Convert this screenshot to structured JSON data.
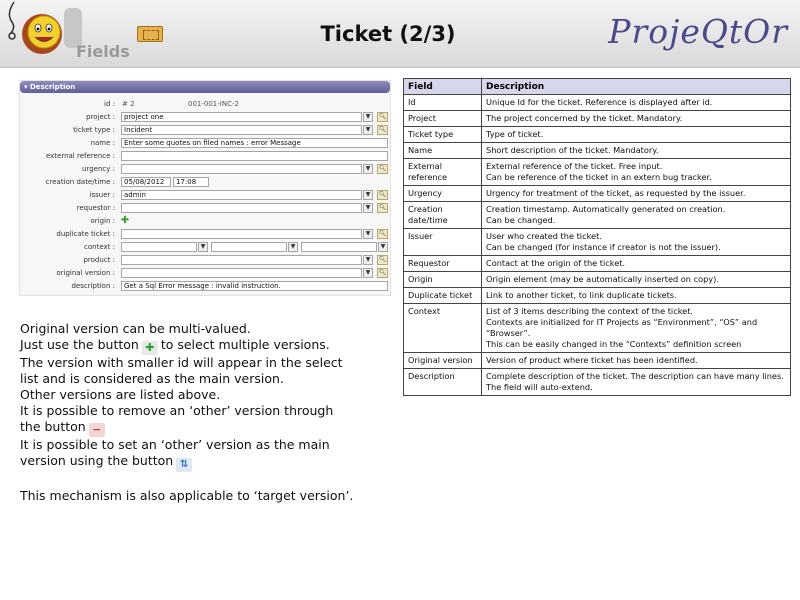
{
  "header": {
    "fields_label": "Fields",
    "title": "Ticket (2/3)",
    "brand": "ProjeQtOr"
  },
  "form": {
    "section_title": "Description",
    "fields": [
      {
        "label": "id :",
        "value": "# 2",
        "extra": "001-001-INC-2"
      },
      {
        "label": "project :",
        "value": "project one"
      },
      {
        "label": "ticket type :",
        "value": "Incident"
      },
      {
        "label": "name :",
        "value": "Enter some quotes on filed names : error Message"
      },
      {
        "label": "external reference :",
        "value": ""
      },
      {
        "label": "urgency :",
        "value": ""
      },
      {
        "label": "creation date/time :",
        "value": "05/08/2012",
        "extra": "17:08"
      },
      {
        "label": "issuer :",
        "value": "admin"
      },
      {
        "label": "requestor :",
        "value": ""
      },
      {
        "label": "origin :",
        "value": ""
      },
      {
        "label": "duplicate ticket :",
        "value": ""
      },
      {
        "label": "context :",
        "value": ""
      },
      {
        "label": "product :",
        "value": ""
      },
      {
        "label": "original version :",
        "value": ""
      },
      {
        "label": "description :",
        "value": "Get a Sql Error message : invalid instruction."
      }
    ]
  },
  "notes": {
    "l1": "Original version can be multi-valued.",
    "l2a": "Just use the button",
    "l2b": "to select multiple versions.",
    "l3": "The version with smaller id will appear in the select",
    "l4": "list and is considered as the main version.",
    "l5": "Other versions are listed above.",
    "l6": "It is possible to remove an ‘other’ version through",
    "l7": "the button",
    "l8": "It is possible to set an ‘other’ version as the main",
    "l9": "version using the button",
    "l10": "This mechanism is also applicable to ‘target version’."
  },
  "table": {
    "headers": [
      "Field",
      "Description"
    ],
    "rows": [
      {
        "field": "Id",
        "desc": [
          "Unique Id for the ticket.  Reference is displayed after id."
        ]
      },
      {
        "field": "Project",
        "desc": [
          "The project concerned by the ticket. Mandatory."
        ]
      },
      {
        "field": "Ticket type",
        "desc": [
          "Type of ticket."
        ]
      },
      {
        "field": "Name",
        "desc": [
          "Short description of the ticket. Mandatory."
        ]
      },
      {
        "field": "External reference",
        "desc": [
          "External reference of the ticket. Free input.",
          "Can be reference of the ticket in an extern bug tracker."
        ]
      },
      {
        "field": "Urgency",
        "desc": [
          "Urgency for treatment of the ticket, as requested by the issuer."
        ]
      },
      {
        "field": "Creation date/time",
        "desc": [
          "Creation timestamp. Automatically generated on creation.",
          "Can be changed."
        ]
      },
      {
        "field": "Issuer",
        "desc": [
          "User who created the ticket.",
          "Can be changed (for instance if creator is not the issuer)."
        ]
      },
      {
        "field": "Requestor",
        "desc": [
          "Contact at the origin of the ticket."
        ]
      },
      {
        "field": "Origin",
        "desc": [
          "Origin element (may be automatically inserted on copy)."
        ]
      },
      {
        "field": "Duplicate ticket",
        "desc": [
          "Link to another ticket, to link duplicate tickets."
        ]
      },
      {
        "field": "Context",
        "desc": [
          "List of 3 items describing the context of the ticket.",
          "Contexts are initialized for IT Projects as “Environment”, “OS” and “Browser”.",
          "This can be easily changed in the “Contexts” definition screen"
        ]
      },
      {
        "field": "Original version",
        "desc": [
          "Version of product where ticket has been identified."
        ]
      },
      {
        "field": "Description",
        "desc": [
          "Complete description of the ticket. The description can have many lines. The field will auto-extend."
        ]
      }
    ]
  }
}
